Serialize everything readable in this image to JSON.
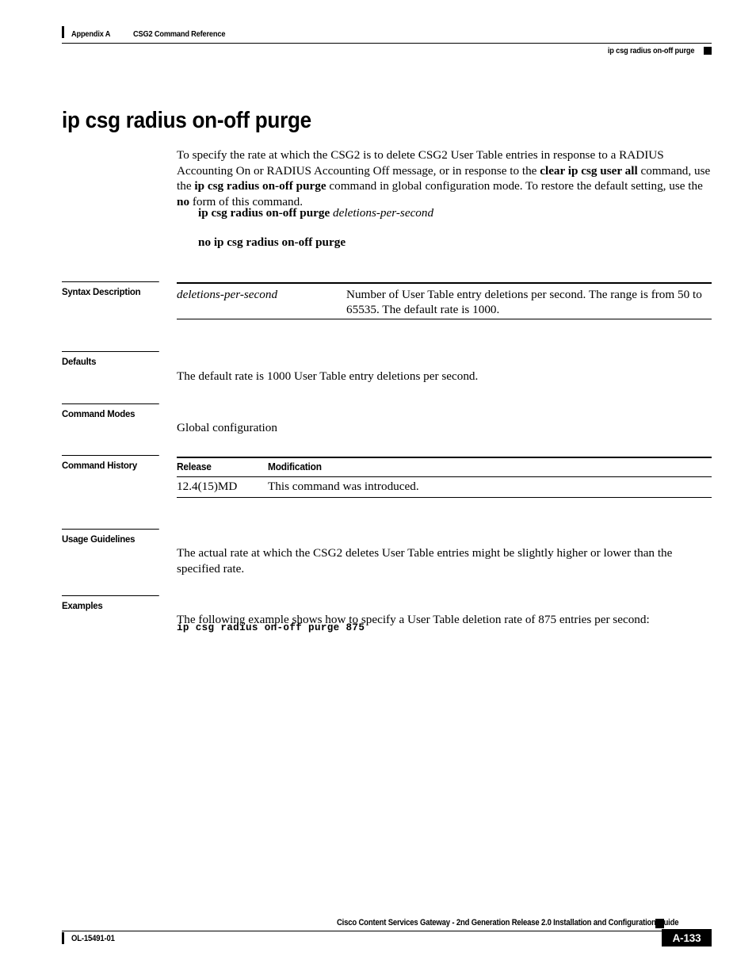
{
  "header": {
    "appendix": "Appendix A",
    "chapter_title": "CSG2 Command Reference",
    "running_command": "ip csg radius on-off purge"
  },
  "title": "ip csg radius on-off purge",
  "intro": {
    "part1": "To specify the rate at which the CSG2 is to delete CSG2 User Table entries in response to a RADIUS Accounting On or RADIUS Accounting Off message, or in response to the ",
    "bold1": "clear ip csg user all",
    "part2": " command, use the ",
    "bold2": "ip csg radius on-off purge",
    "part3": " command in global configuration mode. To restore the default setting, use the ",
    "bold3": "no",
    "part4": " form of this command."
  },
  "syntax": {
    "command_bold": "ip csg radius on-off purge",
    "command_arg": "deletions-per-second",
    "no_form": "no ip csg radius on-off purge"
  },
  "sections": {
    "syntax_description": "Syntax Description",
    "defaults": "Defaults",
    "command_modes": "Command Modes",
    "command_history": "Command History",
    "usage_guidelines": "Usage Guidelines",
    "examples": "Examples"
  },
  "syntax_description_table": {
    "rows": [
      {
        "term": "deletions-per-second",
        "description": "Number of User Table entry deletions per second. The range is from 50 to 65535. The default rate is 1000."
      }
    ]
  },
  "defaults_text": "The default rate is 1000 User Table entry deletions per second.",
  "command_modes_text": "Global configuration",
  "command_history_table": {
    "headers": [
      "Release",
      "Modification"
    ],
    "rows": [
      {
        "release": "12.4(15)MD",
        "modification": "This command was introduced."
      }
    ]
  },
  "usage_guidelines_text": "The actual rate at which the CSG2 deletes User Table entries might be slightly higher or lower than the specified rate.",
  "examples": {
    "intro": "The following example shows how to specify a User Table deletion rate of 875 entries per second:",
    "code": "ip csg radius on-off purge 875"
  },
  "footer": {
    "doc_title": "Cisco Content Services Gateway - 2nd Generation Release 2.0 Installation and Configuration Guide",
    "doc_id": "OL-15491-01",
    "page_number": "A-133"
  }
}
